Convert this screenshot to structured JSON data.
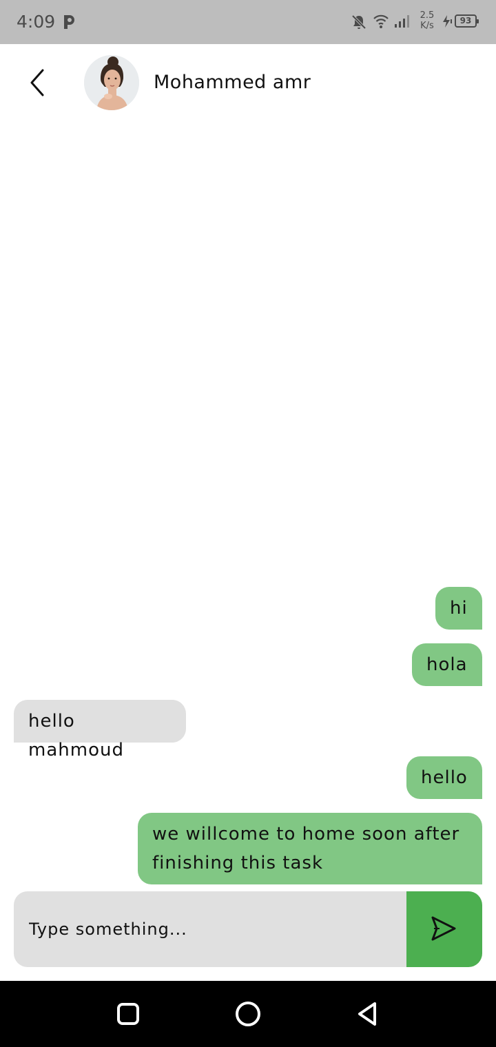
{
  "status_bar": {
    "time": "4:09",
    "net_speed_value": "2.5",
    "net_speed_unit": "K/s",
    "battery_level": "93",
    "icons": [
      "p-app-icon",
      "bell-off-icon",
      "wifi-icon",
      "signal-icon",
      "charging-icon",
      "battery-icon"
    ]
  },
  "header": {
    "contact_name": "Mohammed amr",
    "back_icon": "chevron-left-icon"
  },
  "messages": [
    {
      "direction": "sent",
      "text": "hi"
    },
    {
      "direction": "sent",
      "text": "hola"
    },
    {
      "direction": "received",
      "text": "hello mahmoud"
    },
    {
      "direction": "sent",
      "text": "hello"
    },
    {
      "direction": "sent",
      "text": "we willcome to home soon after finishing this task"
    }
  ],
  "composer": {
    "placeholder": "Type something...",
    "value": "",
    "send_icon": "send-icon"
  },
  "nav_bar": {
    "icons": [
      "recents-square-icon",
      "home-circle-icon",
      "back-triangle-icon"
    ]
  },
  "colors": {
    "sent_bubble": "#81c784",
    "received_bubble": "#e0e0e0",
    "send_button": "#4caf50",
    "status_bar": "#bdbdbd"
  }
}
